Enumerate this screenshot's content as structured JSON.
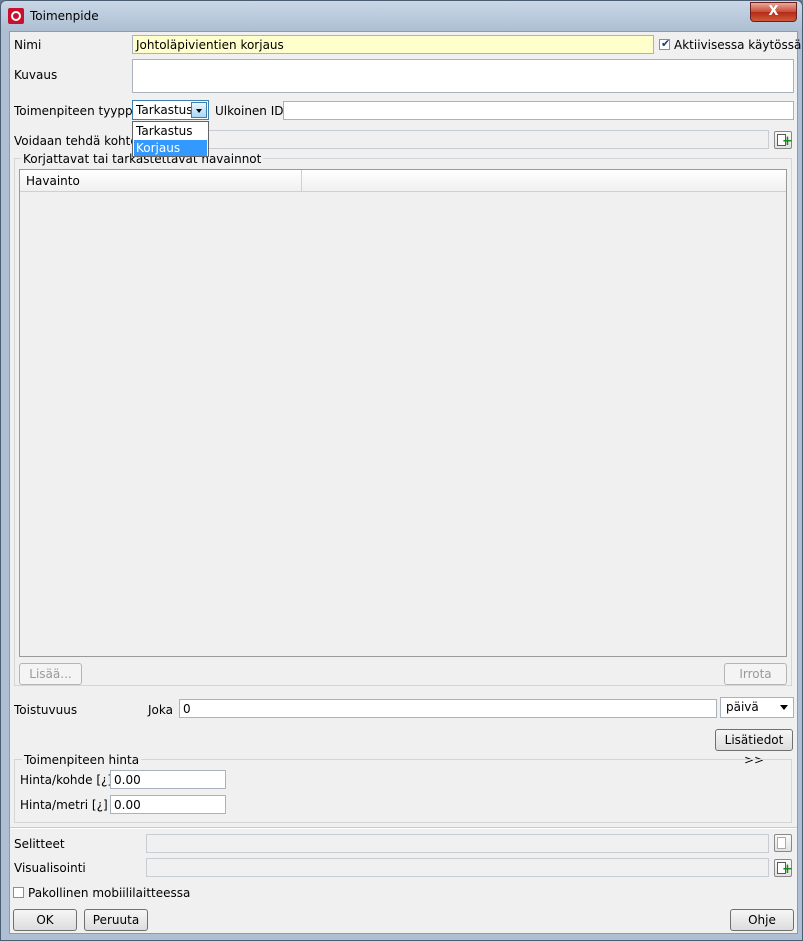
{
  "window": {
    "title": "Toimenpide",
    "close_glyph": "X"
  },
  "form": {
    "name_label": "Nimi",
    "name_value": "Johtoläpivientien korjaus",
    "active_label": "Aktiivisessa käytössä",
    "active_checked": true,
    "desc_label": "Kuvaus",
    "desc_value": "",
    "type_label": "Toimenpiteen tyyppi",
    "type_selected": "Tarkastus",
    "type_options": [
      "Tarkastus",
      "Korjaus"
    ],
    "type_highlighted": "Korjaus",
    "external_id_label": "Ulkoinen ID",
    "external_id_value": "",
    "applicable_label": "Voidaan tehdä kohteille"
  },
  "observations": {
    "group_title": "Korjattavat tai tarkastettavat havainnot",
    "columns": [
      "Havainto",
      ""
    ],
    "add_button": "Lisää...",
    "detach_button": "Irrota"
  },
  "recurrence": {
    "label": "Toistuvuus",
    "every_label": "Joka",
    "value": "0",
    "unit": "päivä",
    "more_button": "Lisätiedot >>"
  },
  "price": {
    "group_title": "Toimenpiteen hinta",
    "per_object_label": "Hinta/kohde [¿]",
    "per_object_value": "0.00",
    "per_meter_label": "Hinta/metri [¿]",
    "per_meter_value": "0.00"
  },
  "bottom": {
    "legends_label": "Selitteet",
    "visualization_label": "Visualisointi",
    "mandatory_mobile_label": "Pakollinen mobiililaitteessa",
    "mandatory_mobile_checked": false
  },
  "footer": {
    "ok": "OK",
    "cancel": "Peruuta",
    "help": "Ohje"
  }
}
